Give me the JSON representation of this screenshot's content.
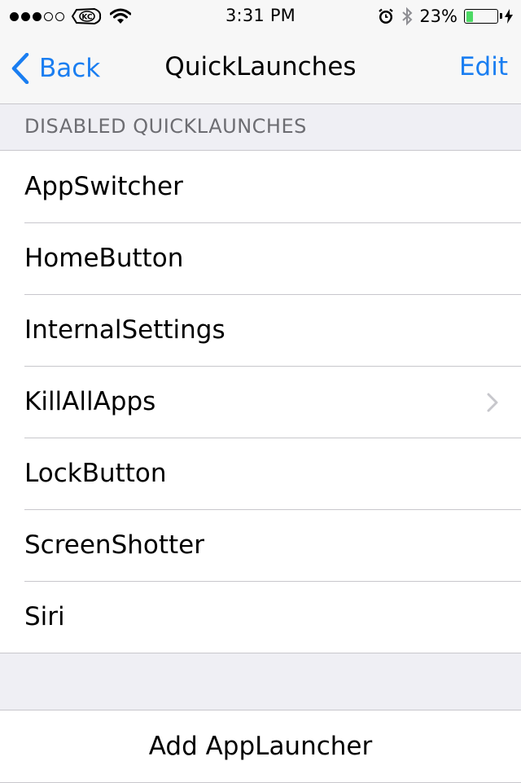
{
  "status_bar": {
    "signal_dots": [
      true,
      true,
      true,
      false,
      false
    ],
    "carrier_icon": "chiefs-logo-icon",
    "time": "3:31 PM",
    "battery_percent": "23%",
    "battery_level": 0.23,
    "battery_color": "#4cd964"
  },
  "nav": {
    "back_label": "Back",
    "title": "QuickLaunches",
    "edit_label": "Edit",
    "accent": "#1a7ef1"
  },
  "section": {
    "header": "DISABLED QUICKLAUNCHES",
    "items": [
      {
        "label": "AppSwitcher",
        "chevron": false
      },
      {
        "label": "HomeButton",
        "chevron": false
      },
      {
        "label": "InternalSettings",
        "chevron": false
      },
      {
        "label": "KillAllApps",
        "chevron": true
      },
      {
        "label": "LockButton",
        "chevron": false
      },
      {
        "label": "ScreenShotter",
        "chevron": false
      },
      {
        "label": "Siri",
        "chevron": false
      }
    ]
  },
  "actions": {
    "add_label": "Add AppLauncher"
  }
}
